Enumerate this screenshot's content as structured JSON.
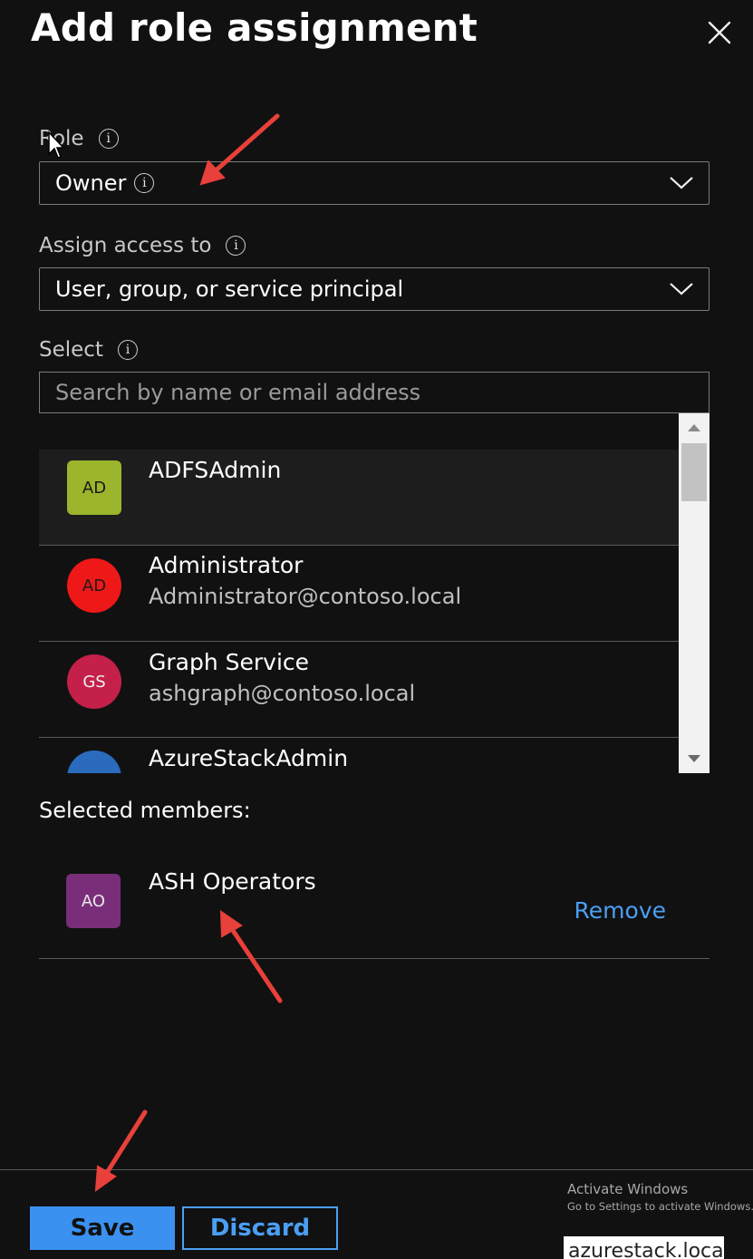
{
  "header": {
    "title": "Add role assignment",
    "close_icon": "close-icon"
  },
  "role": {
    "label": "Role",
    "value": "Owner"
  },
  "assign_access": {
    "label": "Assign access to",
    "value": "User, group, or service principal"
  },
  "select": {
    "label": "Select",
    "placeholder": "Search by name or email address"
  },
  "results": [
    {
      "initials": "AD",
      "name": "ADFSAdmin",
      "email": "",
      "color": "#9bb52c",
      "shape": "square"
    },
    {
      "initials": "AD",
      "name": "Administrator",
      "email": "Administrator@contoso.local",
      "color": "#ef1818",
      "shape": "round"
    },
    {
      "initials": "GS",
      "name": "Graph Service",
      "email": "ashgraph@contoso.local",
      "color": "#c42049",
      "shape": "round"
    },
    {
      "initials": "",
      "name": "AzureStackAdmin",
      "email": "",
      "color": "#2a6bbd",
      "shape": "round"
    }
  ],
  "selected": {
    "label": "Selected members:",
    "members": [
      {
        "initials": "AO",
        "name": "ASH Operators",
        "color": "#7a2e7a",
        "remove_label": "Remove"
      }
    ]
  },
  "footer": {
    "save_label": "Save",
    "discard_label": "Discard"
  },
  "watermark": {
    "line1": "Activate Windows",
    "line2": "Go to Settings to activate Windows."
  },
  "taskbar_text": "azurestack.local",
  "colors": {
    "accent": "#3b91f0",
    "link": "#4b9ff2",
    "annotation_arrow": "#e8403a"
  }
}
